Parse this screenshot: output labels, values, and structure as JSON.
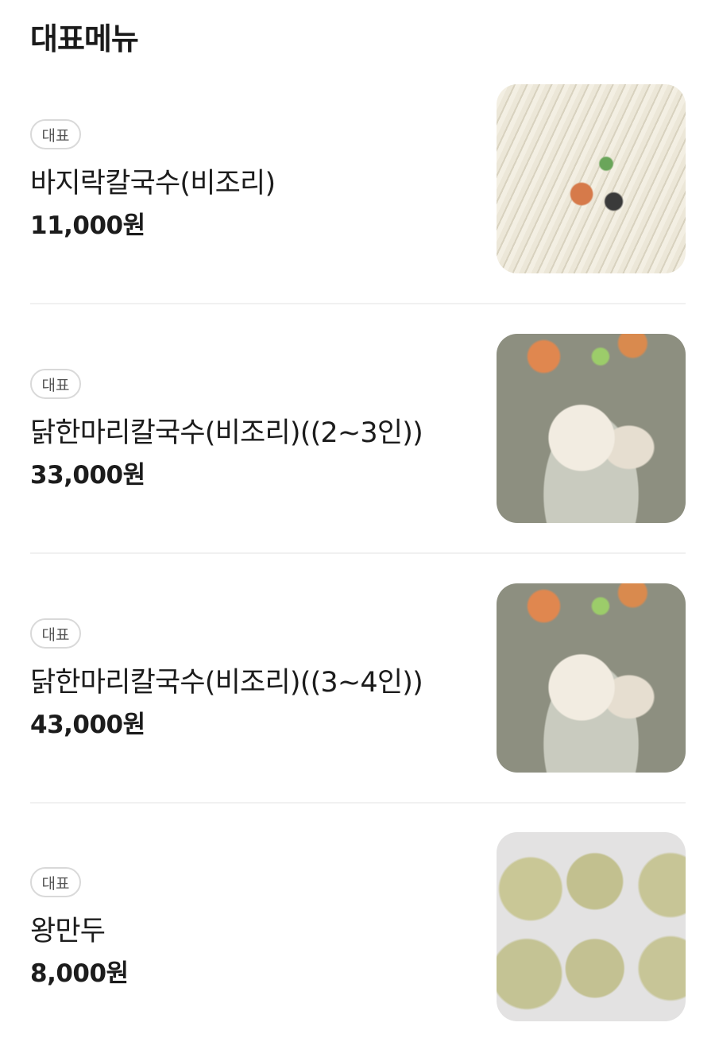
{
  "section_title": "대표메뉴",
  "menu_items": [
    {
      "badge": "대표",
      "name": "바지락칼국수(비조리)",
      "price": "11,000원",
      "photo_icon": "clam-noodle-photo"
    },
    {
      "badge": "대표",
      "name": "닭한마리칼국수(비조리)((2~3인))",
      "price": "33,000원",
      "photo_icon": "chicken-noodle-photo"
    },
    {
      "badge": "대표",
      "name": "닭한마리칼국수(비조리)((3~4인))",
      "price": "43,000원",
      "photo_icon": "chicken-noodle-photo"
    },
    {
      "badge": "대표",
      "name": "왕만두",
      "price": "8,000원",
      "photo_icon": "dumpling-photo"
    }
  ]
}
